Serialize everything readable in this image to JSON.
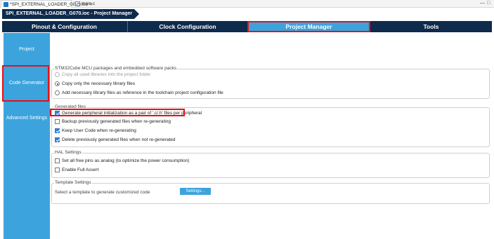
{
  "editor_tabs": [
    {
      "label": "*SPI_EXTERNAL_LOADER_G070.ioc",
      "icon": "mx-file-icon"
    },
    {
      "label": "main.c",
      "icon": "c-file-icon"
    }
  ],
  "window_controls": {
    "minimize": "—",
    "maximize": "□"
  },
  "breadcrumb": "SPI_EXTERNAL_LOADER_G070.ioc - Project Manager",
  "main_tabs": [
    "Pinout & Configuration",
    "Clock Configuration",
    "Project Manager",
    "Tools"
  ],
  "active_main_tab": "Project Manager",
  "left_nav": [
    "Project",
    "Code Generator",
    "Advanced Settings"
  ],
  "active_left_nav": "Code Generator",
  "groups": {
    "packages": {
      "title": "STM32Cube MCU packages and embedded software packs",
      "options": [
        {
          "label": "Copy all used libraries into the project folder",
          "selected": false,
          "disabled": true
        },
        {
          "label": "Copy only the necessary library files",
          "selected": true,
          "disabled": false
        },
        {
          "label": "Add necessary library files as reference in the toolchain project configuration file",
          "selected": false,
          "disabled": false
        }
      ]
    },
    "generated": {
      "title": "Generated files",
      "options": [
        {
          "label": "Generate peripheral initialization as a pair of '.c/.h' files per peripheral",
          "checked": true
        },
        {
          "label": "Backup previously generated files when re-generating",
          "checked": false
        },
        {
          "label": "Keep User Code when re-generating",
          "checked": true
        },
        {
          "label": "Delete previously generated files when not re-generated",
          "checked": true
        }
      ]
    },
    "hal": {
      "title": "HAL Settings",
      "options": [
        {
          "label": "Set all free pins as analog (to optimize the power consumption)",
          "checked": false
        },
        {
          "label": "Enable Full Assert",
          "checked": false
        }
      ]
    },
    "template": {
      "title": "Template Settings",
      "text": "Select a template to generate customized code",
      "button": "Settings..."
    }
  },
  "colors": {
    "navy": "#0e2a4c",
    "accent": "#3ca3dd",
    "highlight": "#e0141b"
  }
}
